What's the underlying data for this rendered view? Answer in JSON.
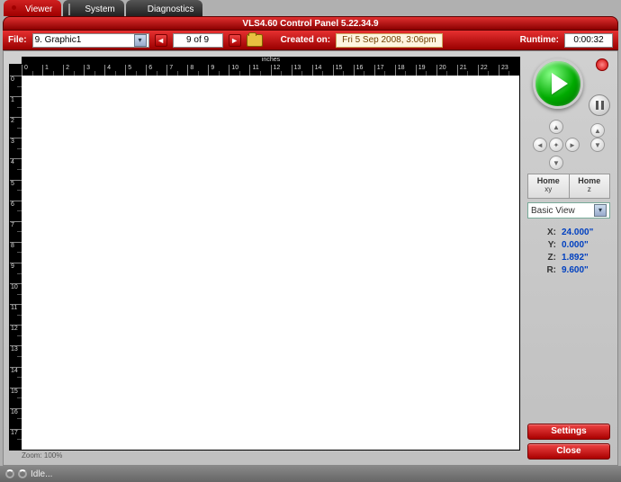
{
  "tabs": {
    "viewer": "Viewer",
    "system": "System",
    "diagnostics": "Diagnostics"
  },
  "titlebar": "VLS4.60   Control Panel   5.22.34.9",
  "toolbar": {
    "file_label": "File:",
    "file_value": "9. Graphic1",
    "page": "9 of 9",
    "created_label": "Created on:",
    "created_value": "Fri 5 Sep 2008,  3:06pm",
    "runtime_label": "Runtime:",
    "runtime_value": "0:00:32"
  },
  "canvas": {
    "ruler_unit": "inches",
    "h_ticks": [
      "0",
      "1",
      "2",
      "3",
      "4",
      "5",
      "6",
      "7",
      "8",
      "9",
      "10",
      "11",
      "12",
      "13",
      "14",
      "15",
      "16",
      "17",
      "18",
      "19",
      "20",
      "21",
      "22",
      "23"
    ],
    "v_ticks": [
      "0",
      "1",
      "2",
      "3",
      "4",
      "5",
      "6",
      "7",
      "8",
      "9",
      "10",
      "11",
      "12",
      "13",
      "14",
      "15",
      "16",
      "17"
    ],
    "zoom": "Zoom: 100%"
  },
  "home": {
    "xy_label": "Home",
    "xy_sub": "xy",
    "z_label": "Home",
    "z_sub": "z"
  },
  "view_select": "Basic View",
  "coords": {
    "x_label": "X:",
    "x_value": "24.000\"",
    "y_label": "Y:",
    "y_value": "0.000\"",
    "z_label": "Z:",
    "z_value": "1.892\"",
    "r_label": "R:",
    "r_value": "9.600\""
  },
  "buttons": {
    "settings": "Settings",
    "close": "Close"
  },
  "status": "Idle..."
}
